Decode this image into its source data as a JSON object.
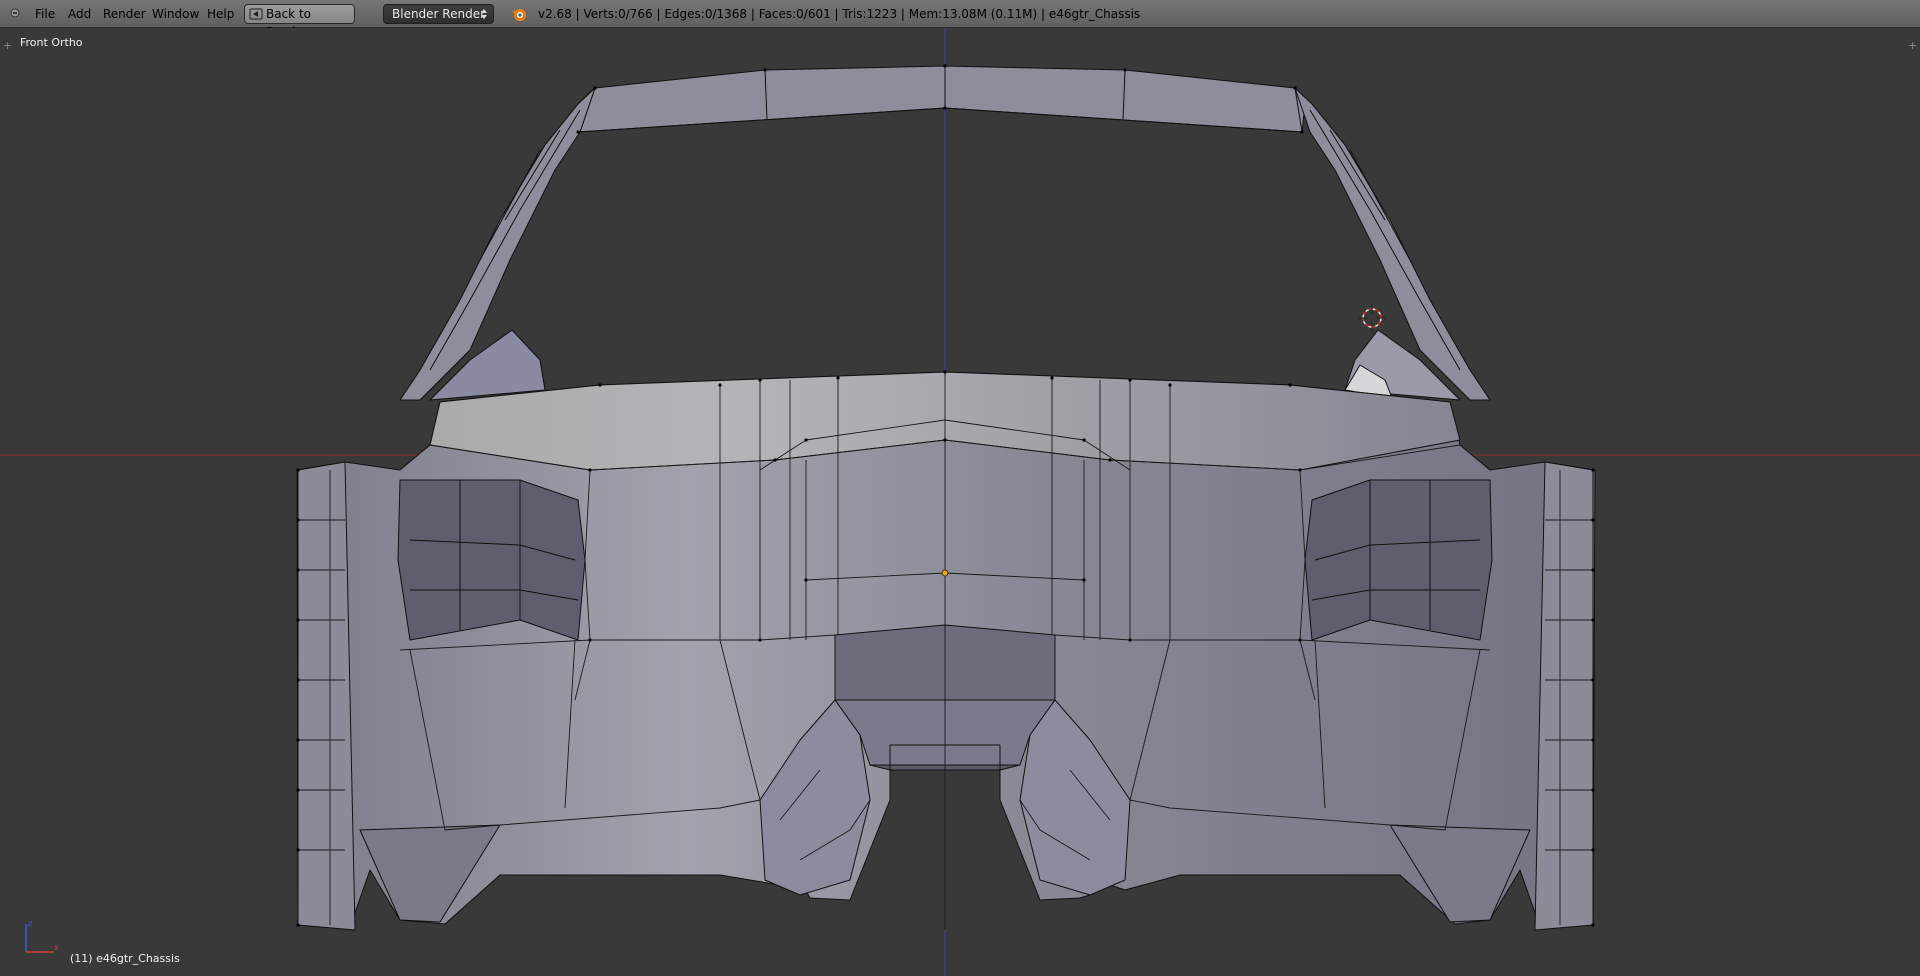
{
  "menu": {
    "file": "File",
    "add": "Add",
    "render": "Render",
    "window": "Window",
    "help": "Help"
  },
  "toolbar": {
    "back_to_previous": "Back to Previous",
    "render_engine": "Blender Render"
  },
  "stats": "v2.68 | Verts:0/766 | Edges:0/1368 | Faces:0/601 | Tris:1223 | Mem:13.08M (0.11M) | e46gtr_Chassis",
  "viewport": {
    "view_name": "Front Ortho",
    "active_object": "(11) e46gtr_Chassis",
    "background": "#393939",
    "x_axis_color": "#8e2a2a",
    "z_axis_color": "#3f3fb5",
    "mesh_color": "#8c8c99"
  },
  "icons": [
    "editor-type-icon",
    "back-arrow-icon",
    "dropdown-arrows-icon",
    "blender-logo-icon",
    "3d-cursor-icon",
    "axis-gizmo-icon"
  ]
}
